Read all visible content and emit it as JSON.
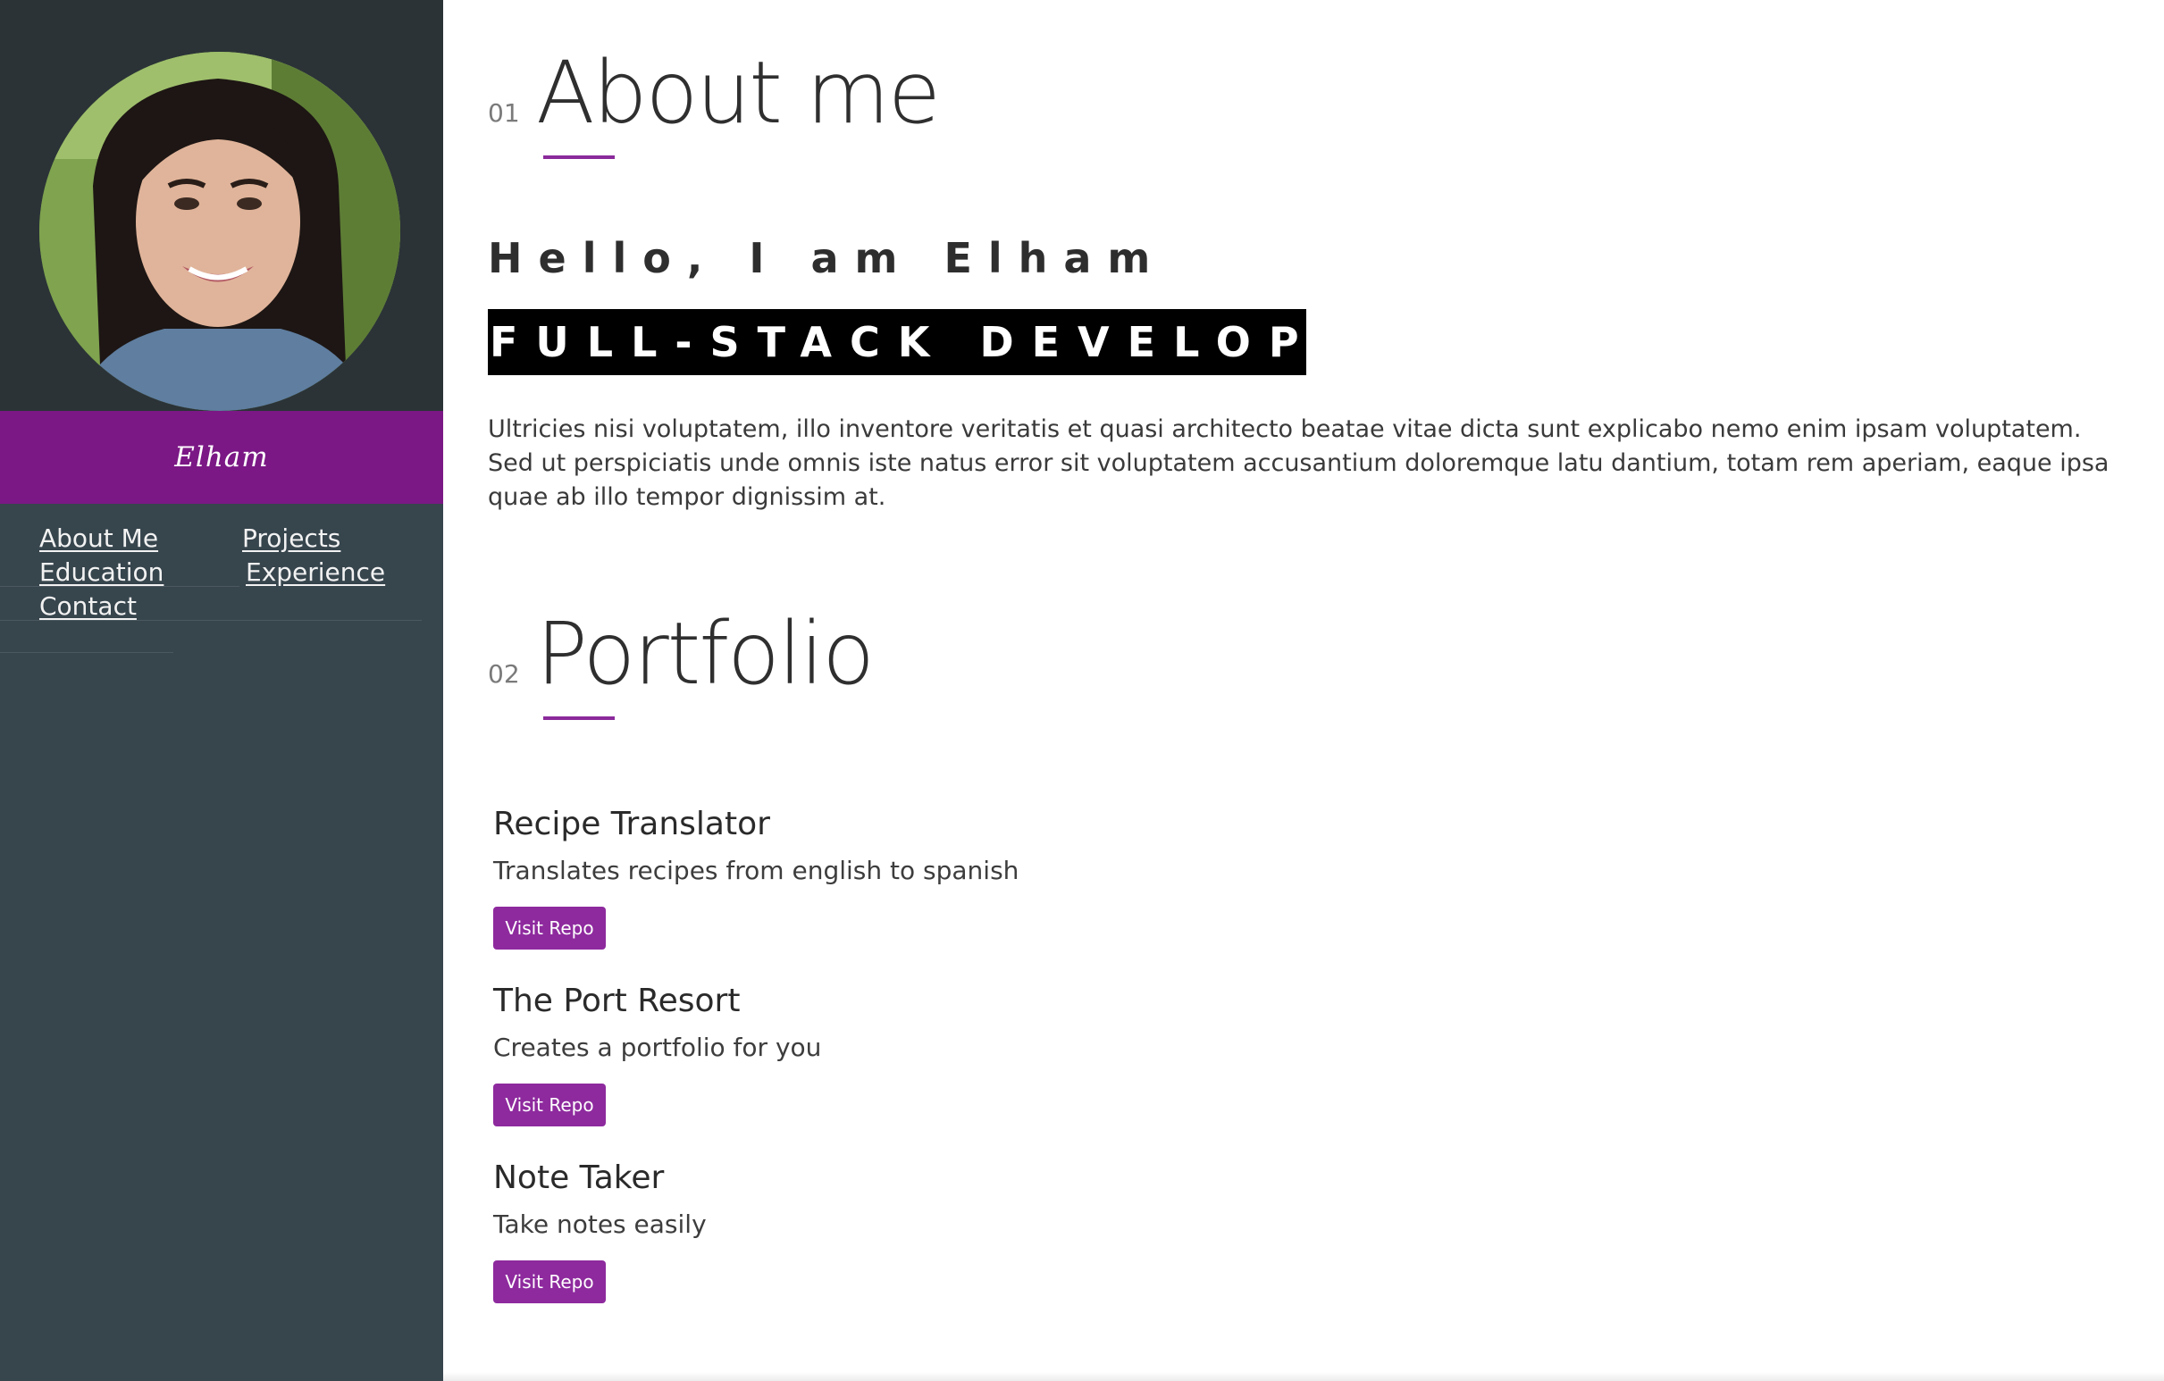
{
  "sidebar": {
    "name": "Elham",
    "nav": {
      "about": "About Me",
      "projects": "Projects",
      "education": "Education",
      "experience": "Experience",
      "contact": "Contact"
    }
  },
  "about": {
    "number": "01",
    "title": "About me",
    "greeting": "Hello, I am Elham",
    "role": "FULL-STACK DEVELOPER",
    "bio": "Ultricies nisi voluptatem, illo inventore veritatis et quasi architecto beatae vitae dicta sunt explicabo nemo enim ipsam voluptatem. Sed ut perspiciatis unde omnis iste natus error sit voluptatem accusantium doloremque latu dantium, totam rem aperiam, eaque ipsa quae ab illo tempor dignissim at."
  },
  "portfolio": {
    "number": "02",
    "title": "Portfolio",
    "projects": [
      {
        "title": "Recipe Translator",
        "description": "Translates recipes from english to spanish",
        "button": "Visit Repo"
      },
      {
        "title": "The Port Resort",
        "description": "Creates a portfolio for you",
        "button": "Visit Repo"
      },
      {
        "title": "Note Taker",
        "description": "Take notes easily",
        "button": "Visit Repo"
      }
    ]
  },
  "colors": {
    "accent": "#8e2a9e",
    "name_bar": "#7b1885",
    "sidebar": "#37454d"
  }
}
